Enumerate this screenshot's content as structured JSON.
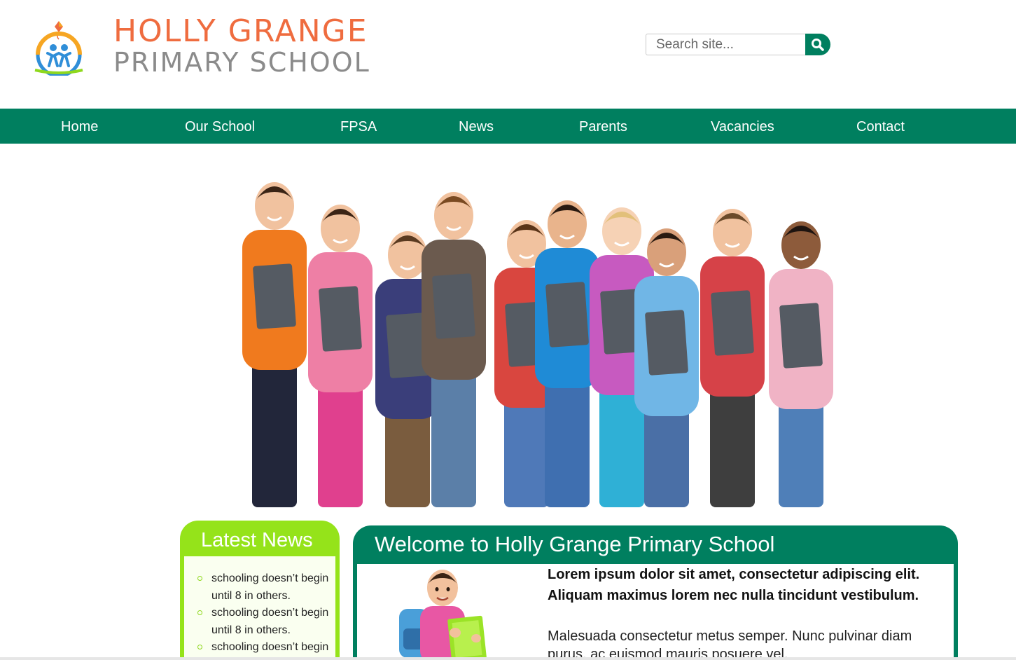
{
  "header": {
    "logo_line1": "HOLLY GRANGE",
    "logo_line2": "PRIMARY SCHOOL",
    "logo_icon": "kite-children-logo",
    "search_placeholder": "Search site...",
    "search_icon": "search-icon"
  },
  "nav": {
    "items": [
      {
        "label": "Home"
      },
      {
        "label": "Our School"
      },
      {
        "label": "FPSA"
      },
      {
        "label": "News"
      },
      {
        "label": "Parents"
      },
      {
        "label": "Vacancies"
      },
      {
        "label": "Contact"
      }
    ]
  },
  "hero": {
    "image": "group-of-schoolchildren-photo"
  },
  "latest_news": {
    "title": "Latest News",
    "items": [
      {
        "text": "schooling doesn’t begin until 8 in others."
      },
      {
        "text": "schooling doesn’t begin until 8 in others."
      },
      {
        "text": "schooling doesn’t begin"
      }
    ]
  },
  "welcome": {
    "title": "Welcome to Holly Grange Primary School",
    "lead": "Lorem ipsum dolor sit amet, consectetur adipiscing elit. Aliquam maximus lorem nec nulla tincidunt vestibulum.",
    "paragraph": "Malesuada consectetur metus semper. Nunc pulvinar diam purus, ac euismod mauris posuere vel.",
    "image": "schoolboy-with-backpack-photo"
  },
  "colors": {
    "brand_green": "#007f5f",
    "news_green": "#95e31a",
    "logo_orange": "#ef6c3f",
    "logo_grey": "#8b8b8b"
  }
}
